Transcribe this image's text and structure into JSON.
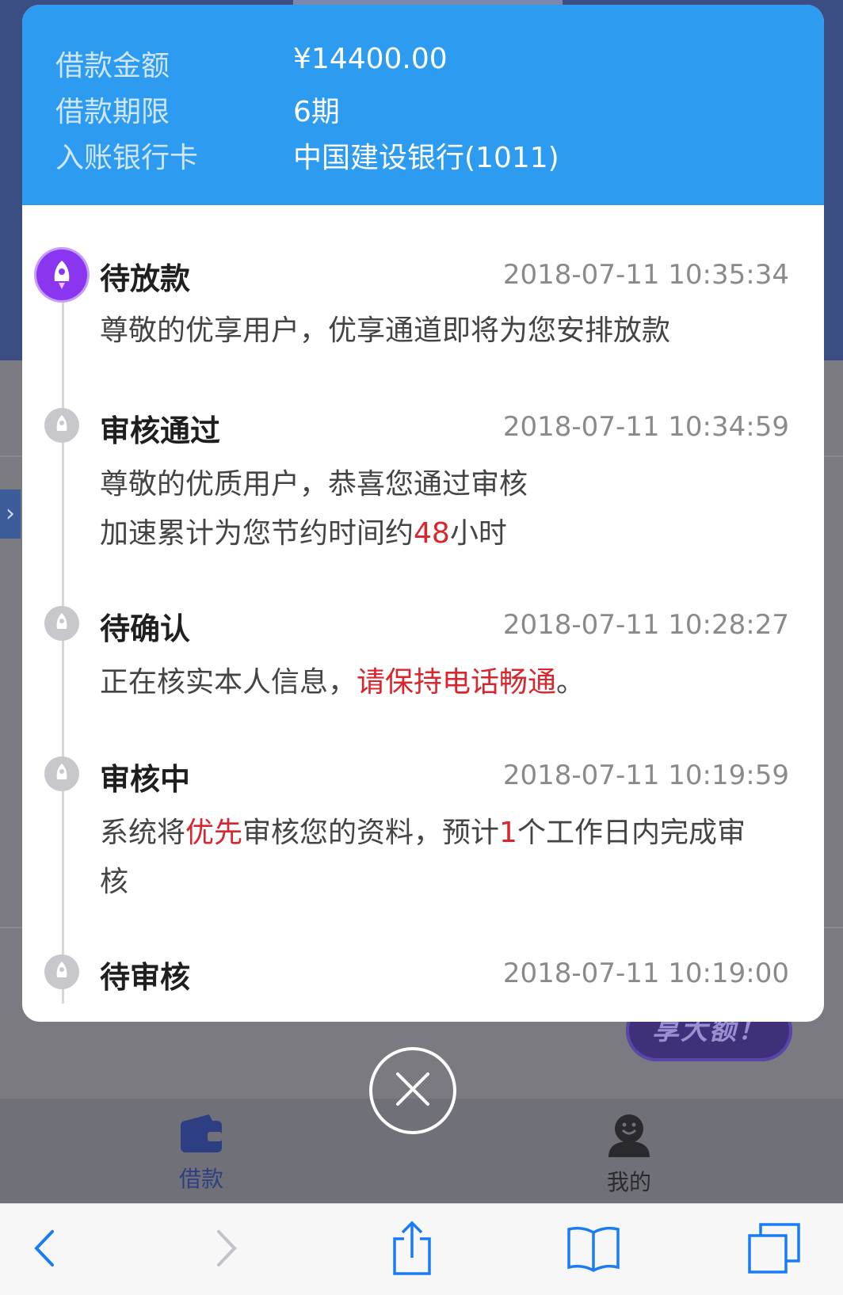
{
  "modal": {
    "rows": [
      {
        "key": "借款金额",
        "value": "¥14400.00"
      },
      {
        "key": "借款期限",
        "value": "6期"
      },
      {
        "key": "入账银行卡",
        "value": "中国建设银行(1011)"
      }
    ],
    "timeline": [
      {
        "title": "待放款",
        "time": "2018-07-11 10:35:34",
        "desc": "尊敬的优享用户，优享通道即将为您安排放款"
      },
      {
        "title": "审核通过",
        "time": "2018-07-11 10:34:59",
        "desc_line1": "尊敬的优质用户，恭喜您通过审核",
        "desc_line2_a": "加速累计为您节约时间约",
        "desc_line2_hl": "48",
        "desc_line2_b": "小时"
      },
      {
        "title": "待确认",
        "time": "2018-07-11 10:28:27",
        "desc_a": "正在核实本人信息，",
        "desc_hl": "请保持电话畅通",
        "desc_b": "。"
      },
      {
        "title": "审核中",
        "time": "2018-07-11 10:19:59",
        "desc_a": "系统将",
        "desc_hl1": "优先",
        "desc_b": "审核您的资料，预计",
        "desc_hl2": "1",
        "desc_c": "个工作日内完成审核"
      },
      {
        "title": "待审核",
        "time": "2018-07-11 10:19:00"
      }
    ]
  },
  "background": {
    "promo_text": "享大额！",
    "tabs": [
      {
        "label": "借款",
        "icon": "wallet-icon",
        "color": "#2d3e82"
      },
      {
        "label": "我的",
        "icon": "user-icon",
        "color": "#2a2a2e"
      }
    ]
  },
  "safari_toolbar": {
    "icons": [
      "back-icon",
      "forward-icon",
      "share-icon",
      "bookmarks-icon",
      "tabs-icon"
    ]
  },
  "colors": {
    "header_blue": "#2d9bf0",
    "active_node": "#8a36f0",
    "highlight_red": "#d8262c"
  }
}
